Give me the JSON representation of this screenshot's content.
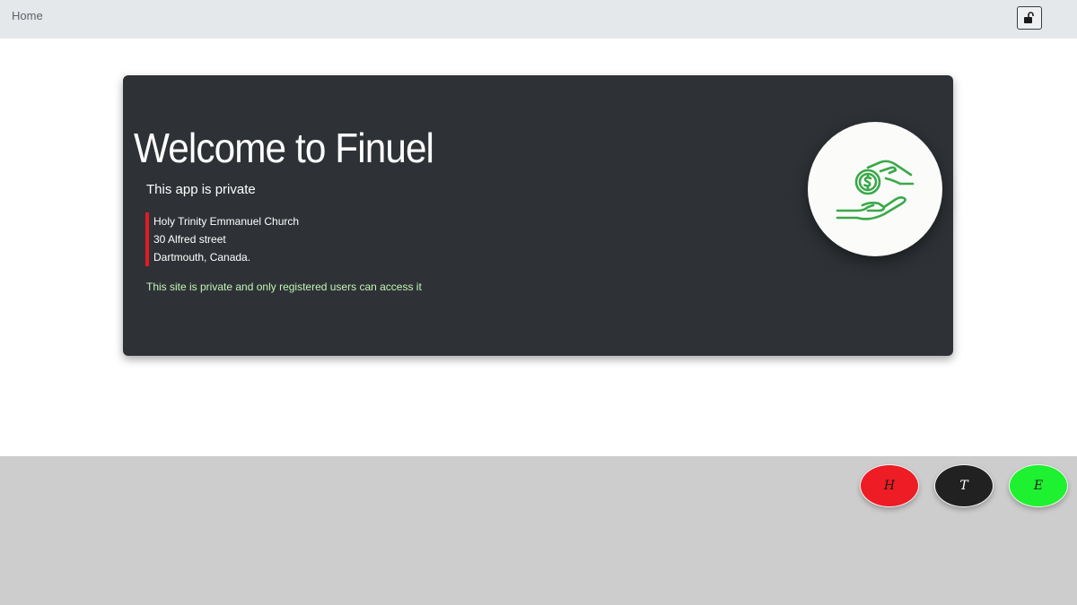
{
  "nav": {
    "home_label": "Home",
    "lock_icon": "unlock-icon"
  },
  "hero": {
    "title": "Welcome to Finuel",
    "subtitle": "This app is private",
    "address_lines": [
      "Holy Trinity Emmanuel Church",
      "30 Alfred street",
      "Dartmouth, Canada."
    ],
    "private_note": "This site is private and only registered users can access it",
    "logo_icon": "hand-giving-coin-icon"
  },
  "footer": {
    "buttons": [
      {
        "label": "H",
        "color": "#ee1c25"
      },
      {
        "label": "T",
        "color": "#212121"
      },
      {
        "label": "E",
        "color": "#1ef12f"
      }
    ]
  },
  "colors": {
    "card_bg": "#2e3236",
    "accent_red": "#e21b23",
    "note_green": "#c3f5b9",
    "logo_green": "#3aa84a"
  }
}
